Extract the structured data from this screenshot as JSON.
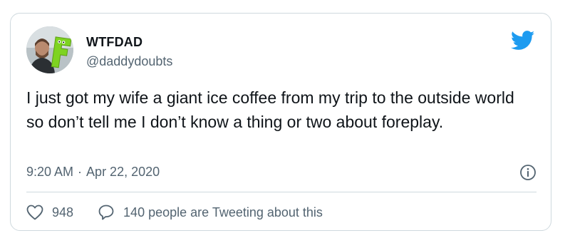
{
  "author": {
    "display_name": "WTFDAD",
    "handle": "@daddydoubts",
    "avatar_badge_letter": "F"
  },
  "tweet": {
    "text": "I just got my wife a giant ice coffee from my trip to the outside world so don’t tell me I don’t know a thing or two about foreplay.",
    "time": "9:20 AM",
    "separator": "·",
    "date": "Apr 22, 2020"
  },
  "stats": {
    "likes": "948",
    "conversation": "140 people are Tweeting about this"
  },
  "icons": {
    "brand": "twitter-bird-icon",
    "info": "info-icon",
    "like": "heart-icon",
    "reply": "speech-bubble-icon"
  },
  "colors": {
    "brand": "#1d9bf0",
    "text": "#0f1419",
    "secondary": "#536471",
    "border": "#cfd9de",
    "badge_green": "#7ed321"
  }
}
